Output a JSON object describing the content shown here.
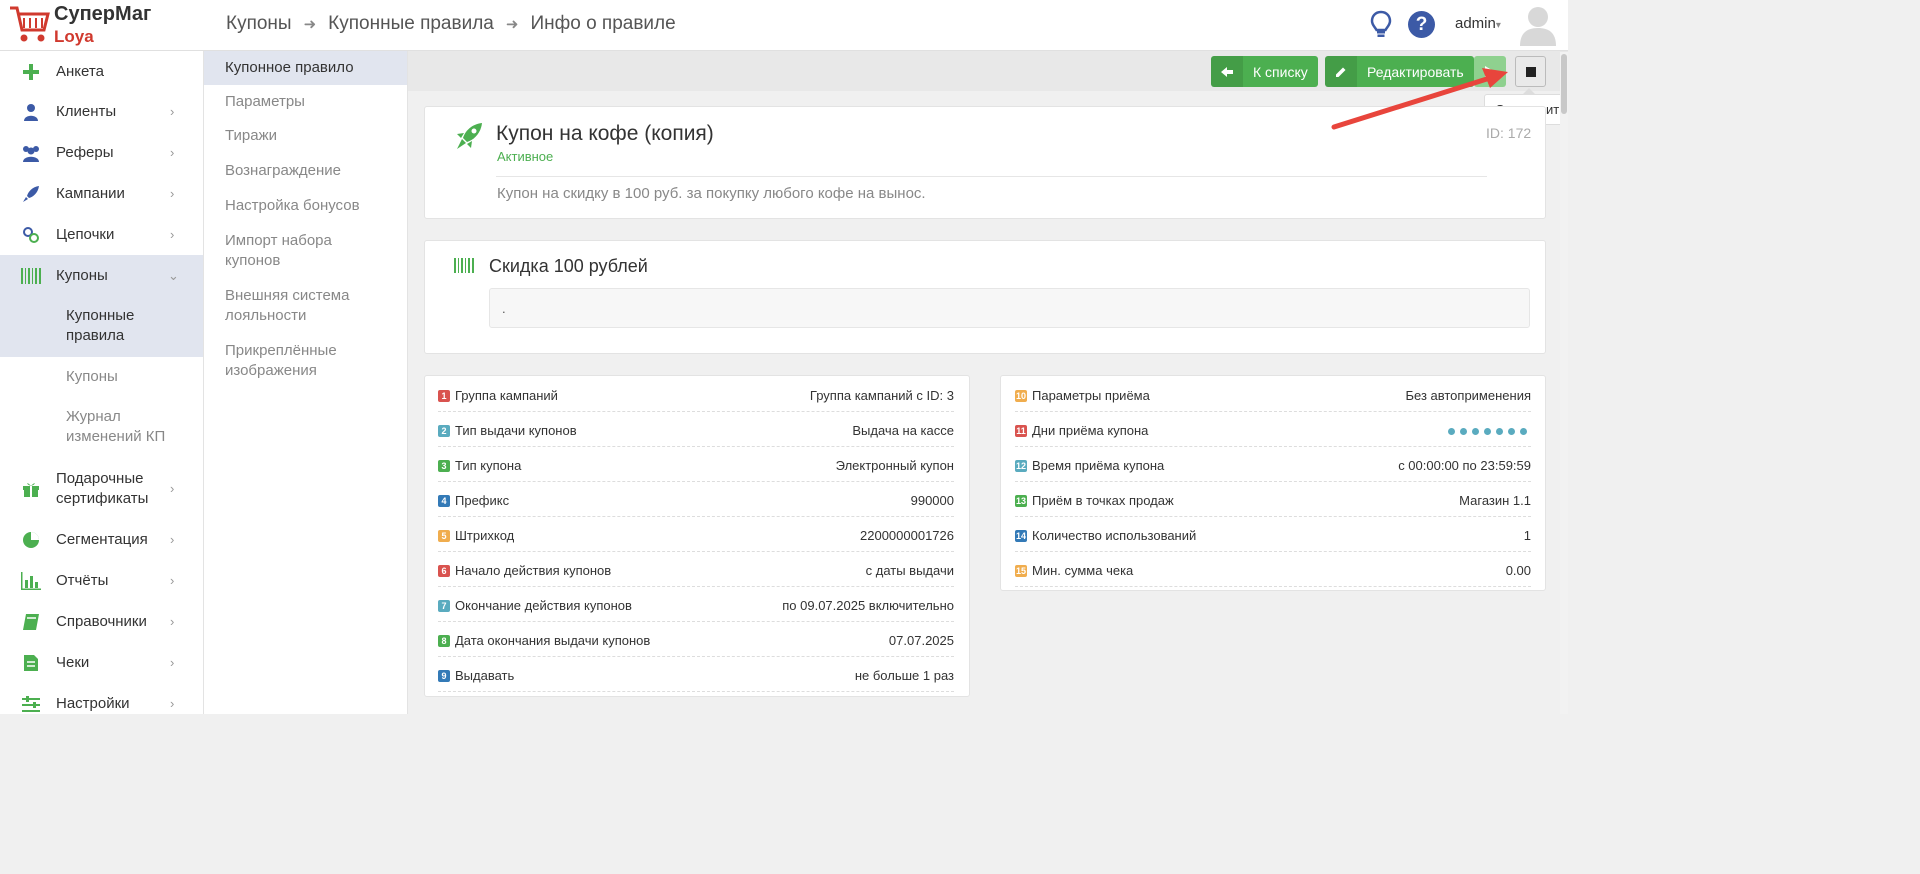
{
  "app": {
    "logo_line1": "СуперМаг",
    "logo_line2": "Loya"
  },
  "breadcrumb": [
    "Купоны",
    "Купонные правила",
    "Инфо о правиле"
  ],
  "header": {
    "user": "admin"
  },
  "sidebar": {
    "items": [
      {
        "label": "Анкета",
        "icon": "plus-icon"
      },
      {
        "label": "Клиенты",
        "icon": "user-icon"
      },
      {
        "label": "Реферы",
        "icon": "users-icon"
      },
      {
        "label": "Кампании",
        "icon": "rocket-icon"
      },
      {
        "label": "Цепочки",
        "icon": "link-icon"
      },
      {
        "label": "Купоны",
        "icon": "barcode-icon"
      },
      {
        "label": "Подарочные сертификаты",
        "icon": "gift-icon"
      },
      {
        "label": "Сегментация",
        "icon": "pie-chart-icon"
      },
      {
        "label": "Отчёты",
        "icon": "bar-chart-icon"
      },
      {
        "label": "Справочники",
        "icon": "book-icon"
      },
      {
        "label": "Чеки",
        "icon": "receipt-icon"
      },
      {
        "label": "Настройки",
        "icon": "sliders-icon"
      }
    ],
    "sub_items": [
      "Купонные правила",
      "Купоны",
      "Журнал изменений КП"
    ]
  },
  "subnav": {
    "items": [
      "Купонное правило",
      "Параметры",
      "Тиражи",
      "Вознаграждение",
      "Настройка бонусов",
      "Импорт набора купонов",
      "Внешняя система лояльности",
      "Прикреплённые изображения"
    ]
  },
  "toolbar": {
    "back_label": "К списку",
    "edit_label": "Редактировать",
    "stop_tooltip": "Остановить"
  },
  "rule": {
    "title": "Купон на кофе (копия)",
    "status": "Активное",
    "id": "ID: 172",
    "description": "Купон на скидку в 100 руб. за покупку любого кофе на вынос."
  },
  "reward": {
    "title": "Скидка 100 рублей",
    "text": "."
  },
  "params_left": [
    {
      "n": "1",
      "key": "Группа кампаний",
      "value": "Группа кампаний с ID: 3",
      "color": "#d9534f"
    },
    {
      "n": "2",
      "key": "Тип выдачи купонов",
      "value": "Выдача на кассе",
      "color": "#5aabbf"
    },
    {
      "n": "3",
      "key": "Тип купона",
      "value": "Электронный купон",
      "color": "#4caf50"
    },
    {
      "n": "4",
      "key": "Префикс",
      "value": "990000",
      "color": "#337ab7"
    },
    {
      "n": "5",
      "key": "Штрихкод",
      "value": "2200000001726",
      "color": "#f0ad4e"
    },
    {
      "n": "6",
      "key": "Начало действия купонов",
      "value": "с даты выдачи",
      "color": "#d9534f"
    },
    {
      "n": "7",
      "key": "Окончание действия купонов",
      "value": "по 09.07.2025 включительно",
      "color": "#5aabbf"
    },
    {
      "n": "8",
      "key": "Дата окончания выдачи купонов",
      "value": "07.07.2025",
      "color": "#4caf50"
    },
    {
      "n": "9",
      "key": "Выдавать",
      "value": "не больше 1 раз",
      "color": "#337ab7"
    }
  ],
  "params_right": [
    {
      "n": "10",
      "key": "Параметры приёма",
      "value": "Без автоприменения",
      "color": "#f0ad4e"
    },
    {
      "n": "11",
      "key": "Дни приёма купона",
      "value": "",
      "color": "#d9534f"
    },
    {
      "n": "12",
      "key": "Время приёма купона",
      "value": "с 00:00:00 по 23:59:59",
      "color": "#5aabbf"
    },
    {
      "n": "13",
      "key": "Приём в точках продаж",
      "value": "Магазин 1.1",
      "color": "#4caf50"
    },
    {
      "n": "14",
      "key": "Количество использований",
      "value": "1",
      "color": "#337ab7"
    },
    {
      "n": "15",
      "key": "Мин. сумма чека",
      "value": "0.00",
      "color": "#f0ad4e"
    }
  ],
  "acceptance_days_count": 7
}
